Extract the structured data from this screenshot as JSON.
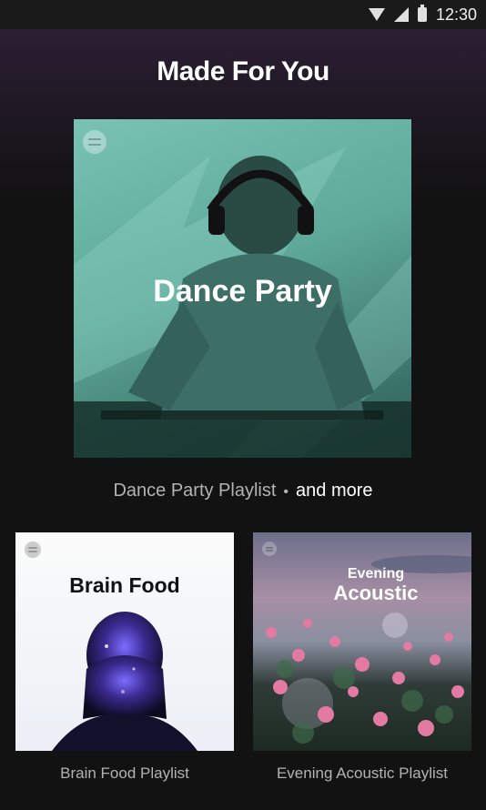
{
  "status_bar": {
    "time": "12:30",
    "icons": [
      "wifi-icon",
      "signal-icon",
      "battery-icon"
    ]
  },
  "header": {
    "title": "Made For You"
  },
  "featured": {
    "cover_title": "Dance Party",
    "playlist_name": "Dance Party Playlist",
    "separator": "•",
    "more_text": "and more"
  },
  "cards": [
    {
      "cover_title": "Brain Food",
      "label": "Brain Food Playlist"
    },
    {
      "cover_title_line1": "Evening",
      "cover_title_line2": "Acoustic",
      "label": "Evening Acoustic Playlist"
    }
  ],
  "colors": {
    "background": "#121212",
    "header_gradient": "#2c1f33",
    "dance_party_teal": "#79c2b4",
    "secondary_text": "#b3b3b3"
  }
}
